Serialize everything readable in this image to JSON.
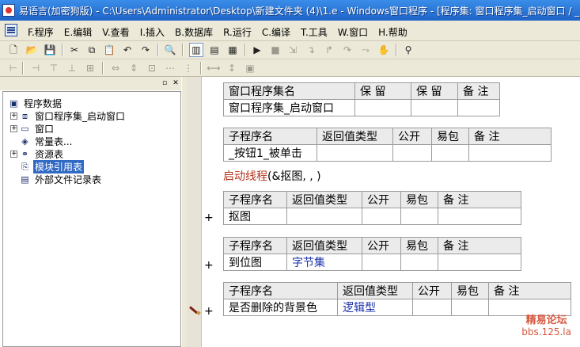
{
  "window": {
    "title": "易语言(加密狗版) - C:\\Users\\Administrator\\Desktop\\新建文件夹 (4)\\1.e - Windows窗口程序 - [程序集: 窗口程序集_启动窗口 / _启"
  },
  "menu": {
    "items": [
      "F.程序",
      "E.编辑",
      "V.查看",
      "I.插入",
      "B.数据库",
      "R.运行",
      "C.编译",
      "T.工具",
      "W.窗口",
      "H.帮助"
    ]
  },
  "toolbar1": {
    "icons": [
      "new-file-icon",
      "open-folder-icon",
      "save-icon",
      "cut-icon",
      "copy-icon",
      "paste-icon",
      "undo-icon",
      "redo-icon",
      "find-icon",
      "panel-left-icon",
      "panel-top-icon",
      "panel-bottom-icon",
      "run-icon",
      "stop-icon",
      "step-icon",
      "step-into-icon",
      "step-out-icon",
      "step-over-icon",
      "breakpoint-hand-icon",
      "binoculars-icon"
    ]
  },
  "tree": {
    "nodes": [
      {
        "label": "程序数据",
        "icon": "program-data-icon",
        "selected": false,
        "expander": ""
      },
      {
        "label": "窗口程序集_启动窗口",
        "icon": "code-set-icon",
        "selected": false,
        "expander": "+"
      },
      {
        "label": "窗口",
        "icon": "window-icon",
        "selected": false,
        "expander": "+"
      },
      {
        "label": "常量表...",
        "icon": "constant-table-icon",
        "selected": false,
        "expander": ""
      },
      {
        "label": "资源表",
        "icon": "resource-table-icon",
        "selected": false,
        "expander": "+"
      },
      {
        "label": "模块引用表",
        "icon": "module-ref-icon",
        "selected": true,
        "expander": ""
      },
      {
        "label": "外部文件记录表",
        "icon": "external-file-icon",
        "selected": false,
        "expander": ""
      }
    ]
  },
  "assembly_table": {
    "headers": [
      "窗口程序集名",
      "保 留",
      "保 留",
      "备 注"
    ],
    "row": [
      "窗口程序集_启动窗口",
      "",
      "",
      ""
    ]
  },
  "subroutines": [
    {
      "headers": [
        "子程序名",
        "返回值类型",
        "公开",
        "易包",
        "备 注"
      ],
      "row": [
        "_按钮1_被单击",
        "",
        "",
        "",
        ""
      ],
      "marker": ""
    },
    {
      "headers": [
        "子程序名",
        "返回值类型",
        "公开",
        "易包",
        "备 注"
      ],
      "row": [
        "抠图",
        "",
        "",
        "",
        ""
      ],
      "marker": "+"
    },
    {
      "headers": [
        "子程序名",
        "返回值类型",
        "公开",
        "易包",
        "备 注"
      ],
      "row": [
        "到位图",
        "字节集",
        "",
        "",
        ""
      ],
      "marker": "+"
    },
    {
      "headers": [
        "子程序名",
        "返回值类型",
        "公开",
        "易包",
        "备 注"
      ],
      "row": [
        "是否删除的背景色",
        "逻辑型",
        "",
        "",
        ""
      ],
      "marker": "+"
    }
  ],
  "thread_line": {
    "keyword": "启动线程",
    "args": "(&抠图, , )"
  },
  "watermark": {
    "line1": "精易论坛",
    "line2": "bbs.125.la"
  }
}
